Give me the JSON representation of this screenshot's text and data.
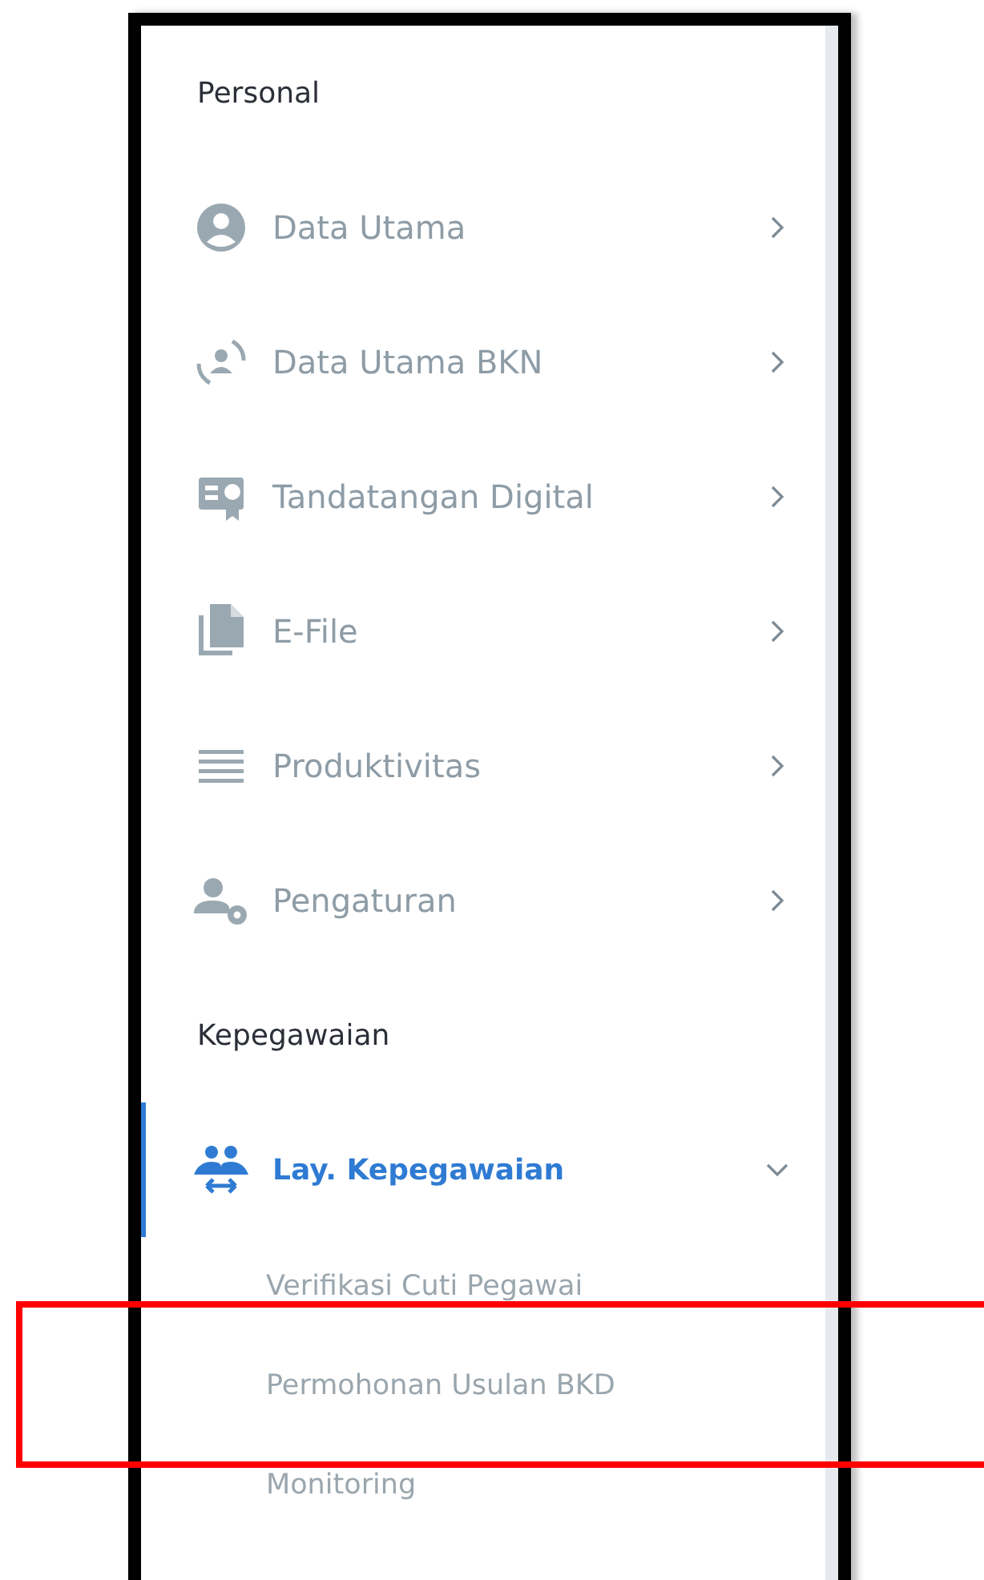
{
  "sidebar": {
    "sections": [
      {
        "heading": "Personal",
        "items": [
          {
            "label": "Data Utama",
            "expanded": false,
            "selected": false
          },
          {
            "label": "Data Utama BKN",
            "expanded": false,
            "selected": false
          },
          {
            "label": "Tandatangan Digital",
            "expanded": false,
            "selected": false
          },
          {
            "label": "E-File",
            "expanded": false,
            "selected": false
          },
          {
            "label": "Produktivitas",
            "expanded": false,
            "selected": false
          },
          {
            "label": "Pengaturan",
            "expanded": false,
            "selected": false
          }
        ]
      },
      {
        "heading": "Kepegawaian",
        "items": [
          {
            "label": "Lay. Kepegawaian",
            "expanded": true,
            "selected": true,
            "children": [
              {
                "label": "Verifikasi Cuti Pegawai",
                "highlighted": false
              },
              {
                "label": "Permohonan Usulan BKD",
                "highlighted": true
              },
              {
                "label": "Monitoring",
                "highlighted": false
              }
            ]
          }
        ]
      }
    ]
  }
}
